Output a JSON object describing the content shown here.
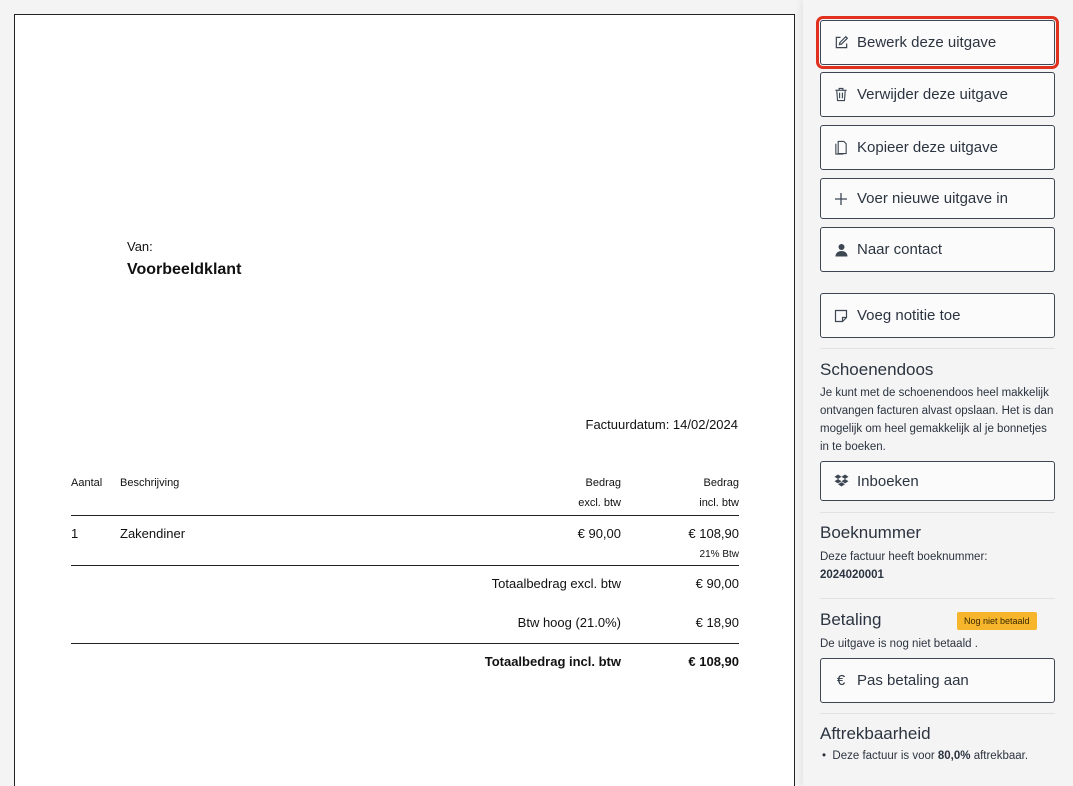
{
  "invoice": {
    "from_label": "Van:",
    "from_name": "Voorbeeldklant",
    "date_text": "Factuurdatum: 14/02/2024",
    "headers": {
      "qty": "Aantal",
      "description": "Beschrijving",
      "excl_top": "Bedrag",
      "excl_bottom": "excl. btw",
      "incl_top": "Bedrag",
      "incl_bottom": "incl. btw"
    },
    "lines": [
      {
        "qty": "1",
        "description": "Zakendiner",
        "excl": "€ 90,00",
        "incl": "€ 108,90",
        "vat": "21% Btw"
      }
    ],
    "totals": {
      "excl_label": "Totaalbedrag excl. btw",
      "excl_value": "€ 90,00",
      "vat_label": "Btw hoog (21.0%)",
      "vat_value": "€ 18,90",
      "incl_label": "Totaalbedrag incl. btw",
      "incl_value": "€ 108,90"
    }
  },
  "sidebar": {
    "buttons": {
      "edit": "Bewerk deze uitgave",
      "delete": "Verwijder deze uitgave",
      "copy": "Kopieer deze uitgave",
      "new": "Voer nieuwe uitgave in",
      "contact": "Naar contact",
      "note": "Voeg notitie toe",
      "inboeken": "Inboeken",
      "payment": "Pas betaling aan"
    },
    "schoenendoos": {
      "title": "Schoenendoos",
      "text": "Je kunt met de schoenendoos heel makkelijk ontvangen facturen alvast opslaan. Het is dan mogelijk om heel gemakkelijk al je bonnetjes in te boeken."
    },
    "boeknummer": {
      "title": "Boeknummer",
      "text": "Deze factuur heeft boeknummer:",
      "number": "2024020001"
    },
    "betaling": {
      "title": "Betaling",
      "badge": "Nog niet betaald",
      "text": "De uitgave is nog niet betaald ."
    },
    "aftrek": {
      "title": "Aftrekbaarheid",
      "text_before": "Deze factuur is voor ",
      "percent": "80,0%",
      "text_after": " aftrekbaar."
    }
  },
  "colors": {
    "highlight": "#e0301e",
    "badge": "#f7b52c",
    "button_border": "#3d4753"
  }
}
